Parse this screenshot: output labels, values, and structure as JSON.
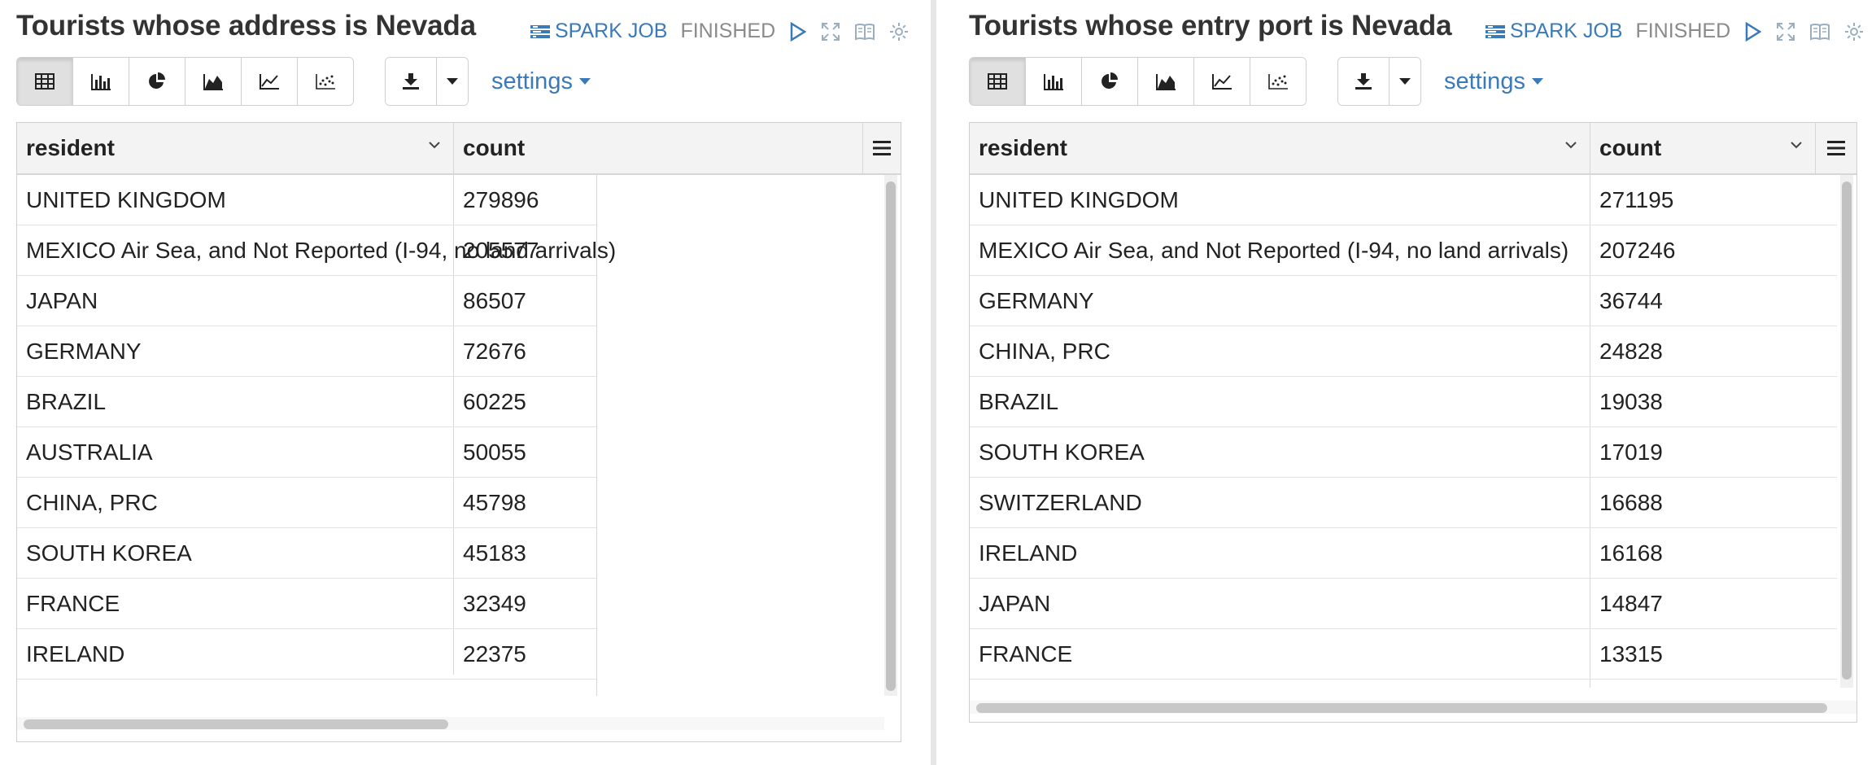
{
  "left": {
    "title": "Tourists whose address is Nevada",
    "job_link": "SPARK JOB",
    "status": "FINISHED",
    "settings_label": "settings",
    "columns": [
      "resident",
      "count"
    ],
    "rows": [
      [
        "UNITED KINGDOM",
        "279896"
      ],
      [
        "MEXICO Air Sea, and Not Reported (I-94, no land arrivals)",
        "205577"
      ],
      [
        "JAPAN",
        "86507"
      ],
      [
        "GERMANY",
        "72676"
      ],
      [
        "BRAZIL",
        "60225"
      ],
      [
        "AUSTRALIA",
        "50055"
      ],
      [
        "CHINA, PRC",
        "45798"
      ],
      [
        "SOUTH KOREA",
        "45183"
      ],
      [
        "FRANCE",
        "32349"
      ],
      [
        "IRELAND",
        "22375"
      ]
    ]
  },
  "right": {
    "title": "Tourists whose entry port is Nevada",
    "job_link": "SPARK JOB",
    "status": "FINISHED",
    "settings_label": "settings",
    "columns": [
      "resident",
      "count"
    ],
    "rows": [
      [
        "UNITED KINGDOM",
        "271195"
      ],
      [
        "MEXICO Air Sea, and Not Reported (I-94, no land arrivals)",
        "207246"
      ],
      [
        "GERMANY",
        "36744"
      ],
      [
        "CHINA, PRC",
        "24828"
      ],
      [
        "BRAZIL",
        "19038"
      ],
      [
        "SOUTH KOREA",
        "17019"
      ],
      [
        "SWITZERLAND",
        "16688"
      ],
      [
        "IRELAND",
        "16168"
      ],
      [
        "JAPAN",
        "14847"
      ],
      [
        "FRANCE",
        "13315"
      ]
    ]
  },
  "icons": {
    "job": "spark-job-icon",
    "run": "play-icon",
    "expand": "expand-icon",
    "book": "book-icon",
    "settings": "gear-icon",
    "views": [
      "table-icon",
      "bar-chart-icon",
      "pie-chart-icon",
      "area-chart-icon",
      "line-chart-icon",
      "scatter-chart-icon"
    ],
    "download": "download-icon",
    "dropdown": "caret-down-icon",
    "sort": "chevron-down-icon",
    "grid_menu": "hamburger-menu-icon"
  },
  "colors": {
    "link": "#3a7ab8",
    "status": "#8a8a8a",
    "header_bg": "#f3f3f3",
    "active_btn": "#e0e0e0"
  }
}
